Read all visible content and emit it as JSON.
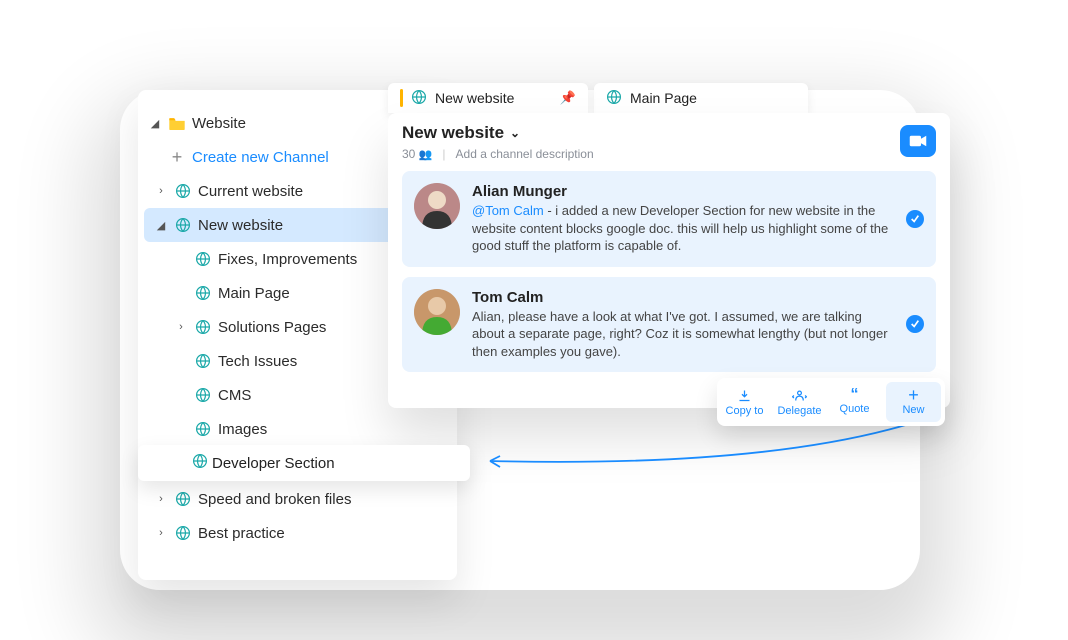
{
  "sidebar": {
    "root": "Website",
    "create": "Create new Channel",
    "items": [
      "Current website",
      "New website",
      "Fixes, Improvements",
      "Main Page",
      "Solutions Pages",
      "Tech Issues",
      "CMS",
      "Images",
      "Developer Section",
      "Speed and broken files",
      "Best practice"
    ]
  },
  "tabs": {
    "active": "New website",
    "other": "Main Page"
  },
  "chat": {
    "title": "New website",
    "members": "30",
    "desc_placeholder": "Add a channel description",
    "messages": [
      {
        "author": "Alian Munger",
        "mention": "@Tom Calm",
        "text": " - i added a new Developer Section for new website in the website content blocks google doc. this will help us highlight some of the good stuff the platform is capable of."
      },
      {
        "author": "Tom Calm",
        "text": "Alian, please have a look at what I've got. I assumed, we are talking about a separate page, right? Coz it is somewhat lengthy (but not longer then examples you gave)."
      }
    ]
  },
  "actions": {
    "copy": "Copy to",
    "delegate": "Delegate",
    "quote": "Quote",
    "new": "New"
  }
}
